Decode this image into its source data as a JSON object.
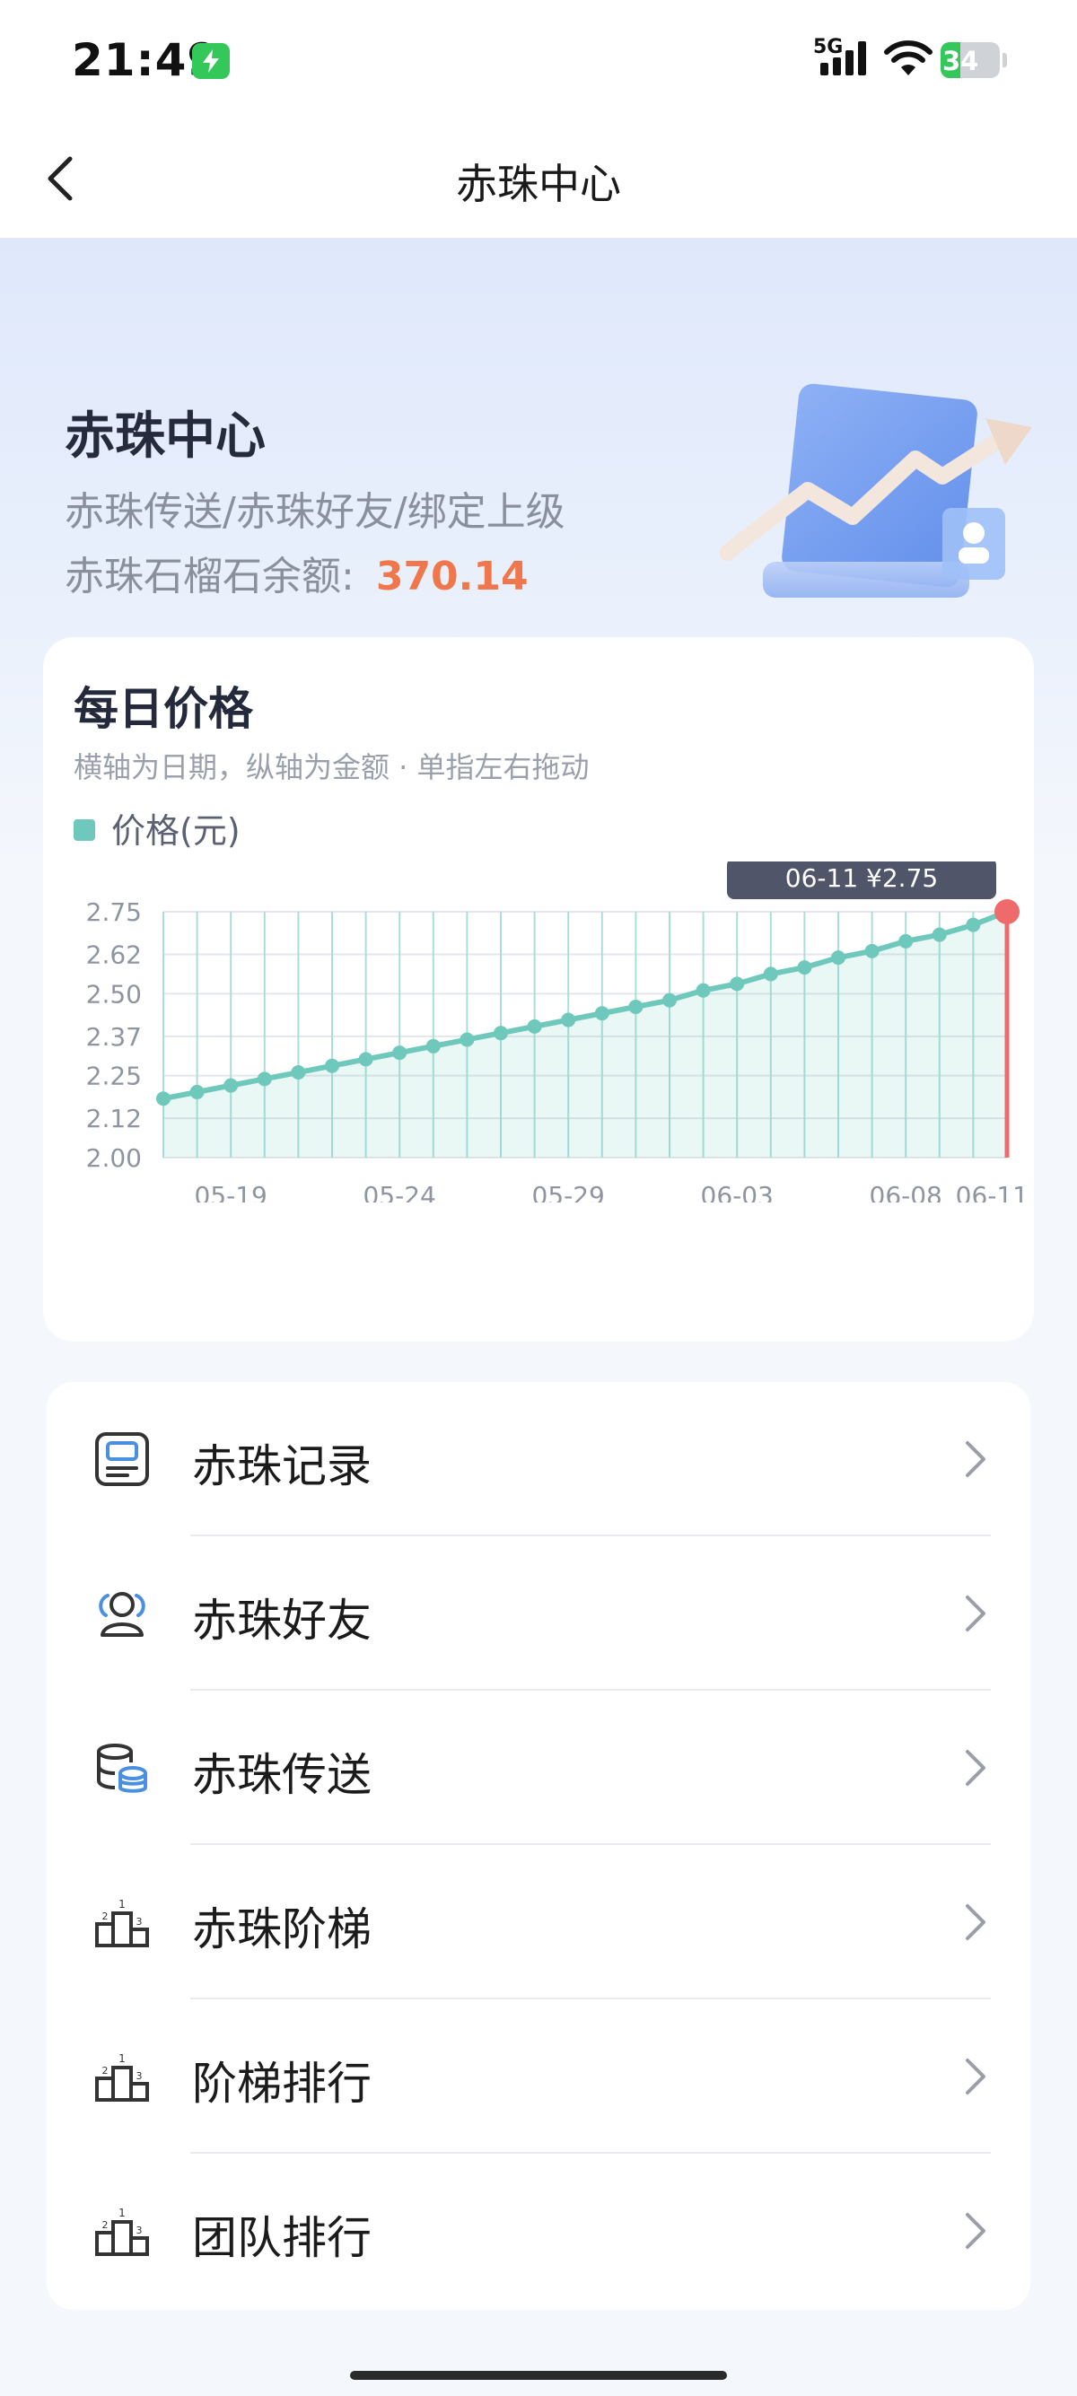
{
  "status_bar": {
    "time": "21:49",
    "network": "5G",
    "battery": 34,
    "icons": [
      "charging-icon",
      "signal-icon",
      "wifi-icon",
      "battery-icon"
    ]
  },
  "nav": {
    "title": "赤珠中心",
    "back_icon": "chevron-left-icon"
  },
  "hero": {
    "title": "赤珠中心",
    "subtitle": "赤珠传送/赤珠好友/绑定上级",
    "balance_label": "赤珠石榴石余额:",
    "balance_value": "370.14"
  },
  "card": {
    "title": "每日价格",
    "subtitle": "横轴为日期，纵轴为金额 · 单指左右拖动",
    "legend": "价格(元)"
  },
  "chart_data": {
    "type": "area",
    "title": "每日价格",
    "series": [
      {
        "name": "价格(元)",
        "color": "#6ec9bc",
        "values": [
          2.18,
          2.2,
          2.22,
          2.24,
          2.26,
          2.28,
          2.3,
          2.32,
          2.34,
          2.36,
          2.38,
          2.4,
          2.42,
          2.44,
          2.46,
          2.48,
          2.51,
          2.53,
          2.56,
          2.58,
          2.61,
          2.63,
          2.66,
          2.68,
          2.71,
          2.75
        ]
      }
    ],
    "x": [
      "05-17",
      "05-18",
      "05-19",
      "05-20",
      "05-21",
      "05-22",
      "05-23",
      "05-24",
      "05-25",
      "05-26",
      "05-27",
      "05-28",
      "05-29",
      "05-30",
      "05-31",
      "06-01",
      "06-02",
      "06-03",
      "06-04",
      "06-05",
      "06-06",
      "06-07",
      "06-08",
      "06-09",
      "06-10",
      "06-11"
    ],
    "x_tick_labels": [
      "05-19",
      "05-24",
      "05-29",
      "06-03",
      "06-08",
      "06-11"
    ],
    "y_tick_labels": [
      "2.75",
      "2.62",
      "2.50",
      "2.37",
      "2.25",
      "2.12",
      "2.00"
    ],
    "ylim": [
      2.0,
      2.75
    ],
    "grid": true,
    "highlight_color": "#ef6b6b",
    "tooltip": "06-11  ¥2.75"
  },
  "menu": {
    "items": [
      {
        "label": "赤珠记录",
        "icon": "record-icon"
      },
      {
        "label": "赤珠好友",
        "icon": "friends-icon"
      },
      {
        "label": "赤珠传送",
        "icon": "transfer-icon"
      },
      {
        "label": "赤珠阶梯",
        "icon": "podium-icon"
      },
      {
        "label": "阶梯排行",
        "icon": "podium-icon"
      },
      {
        "label": "团队排行",
        "icon": "podium-icon"
      }
    ],
    "chevron_icon": "chevron-right-icon"
  }
}
